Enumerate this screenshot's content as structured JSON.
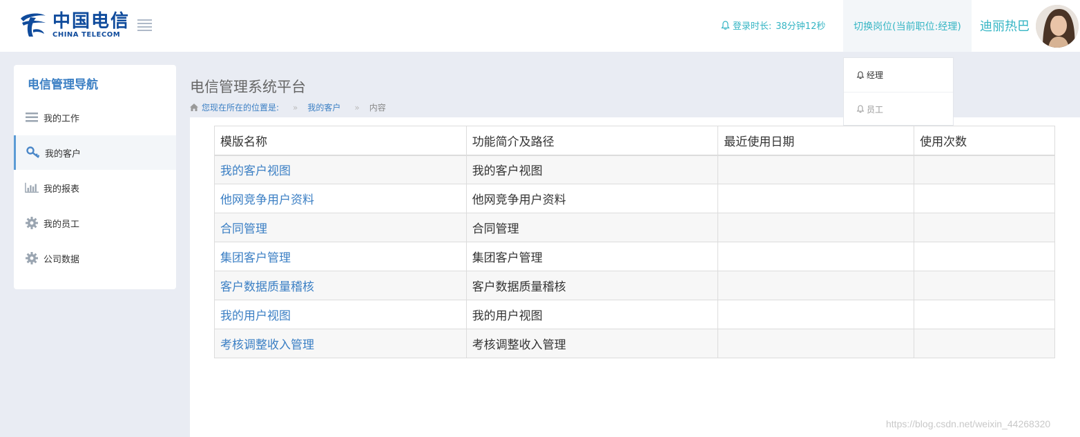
{
  "header": {
    "logo_cn": "中国电信",
    "logo_en": "CHINA TELECOM",
    "login_label": "登录时长:",
    "login_value": "38分钟12秒",
    "switch_role": "切换岗位(当前职位:经理)",
    "username": "迪丽热巴"
  },
  "dropdown": {
    "items": [
      {
        "label": "经理"
      },
      {
        "label": "员工"
      }
    ]
  },
  "sidebar": {
    "title": "电信管理导航",
    "items": [
      {
        "label": "我的工作",
        "icon": "list-icon"
      },
      {
        "label": "我的客户",
        "icon": "key-icon"
      },
      {
        "label": "我的报表",
        "icon": "bar-chart-icon"
      },
      {
        "label": "我的员工",
        "icon": "gear-icon"
      },
      {
        "label": "公司数据",
        "icon": "gear-icon"
      }
    ]
  },
  "main": {
    "title": "电信管理系统平台",
    "breadcrumb": {
      "prefix": "您现在所在的位置是:",
      "sep1": "»",
      "link": "我的客户",
      "sep2": "»",
      "current": "内容"
    },
    "table": {
      "headers": [
        "模版名称",
        "功能简介及路径",
        "最近使用日期",
        "使用次数"
      ],
      "rows": [
        {
          "name": "我的客户视图",
          "desc": "我的客户视图",
          "date": "",
          "count": ""
        },
        {
          "name": "他网竞争用户资料",
          "desc": "他网竞争用户资料",
          "date": "",
          "count": ""
        },
        {
          "name": "合同管理",
          "desc": "合同管理",
          "date": "",
          "count": ""
        },
        {
          "name": "集团客户管理",
          "desc": "集团客户管理",
          "date": "",
          "count": ""
        },
        {
          "name": "客户数据质量稽核",
          "desc": "客户数据质量稽核",
          "date": "",
          "count": ""
        },
        {
          "name": "我的用户视图",
          "desc": "我的用户视图",
          "date": "",
          "count": ""
        },
        {
          "name": "考核调整收入管理",
          "desc": "考核调整收入管理",
          "date": "",
          "count": ""
        }
      ]
    }
  },
  "watermark": "https://blog.csdn.net/weixin_44268320",
  "colors": {
    "accent": "#35b5c4",
    "link": "#3b7fc4",
    "brand": "#0f4b9c",
    "background": "#e9ecf3"
  }
}
